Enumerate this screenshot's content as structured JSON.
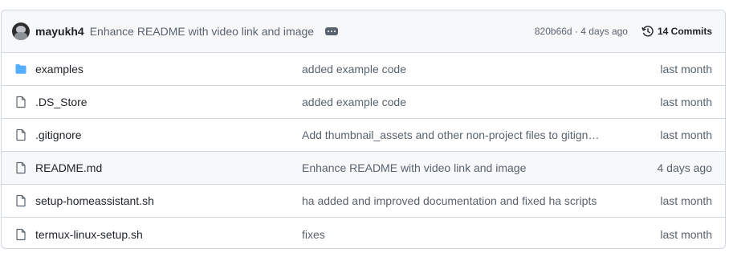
{
  "commit": {
    "author": "mayukh4",
    "message": "Enhance README with video link and image",
    "sha_and_time": "820b66d · 4 days ago",
    "commits_label": "14 Commits"
  },
  "files": [
    {
      "name": "examples",
      "type": "folder",
      "message": "added example code",
      "date": "last month"
    },
    {
      "name": ".DS_Store",
      "type": "file",
      "message": "added example code",
      "date": "last month"
    },
    {
      "name": ".gitignore",
      "type": "file",
      "message": "Add thumbnail_assets and other non-project files to gitign…",
      "date": "last month"
    },
    {
      "name": "README.md",
      "type": "file",
      "message": "Enhance README with video link and image",
      "date": "4 days ago"
    },
    {
      "name": "setup-homeassistant.sh",
      "type": "file",
      "message": "ha added and improved documentation and fixed ha scripts",
      "date": "last month"
    },
    {
      "name": "termux-linux-setup.sh",
      "type": "file",
      "message": "fixes",
      "date": "last month"
    }
  ],
  "colors": {
    "folder": "#54aeff",
    "file_icon": "#59636e",
    "highlight_row": "#f6f8fa"
  },
  "icons": {
    "folder": "folder-icon",
    "file": "file-icon",
    "history": "history-icon",
    "more": "ellipsis-icon"
  }
}
